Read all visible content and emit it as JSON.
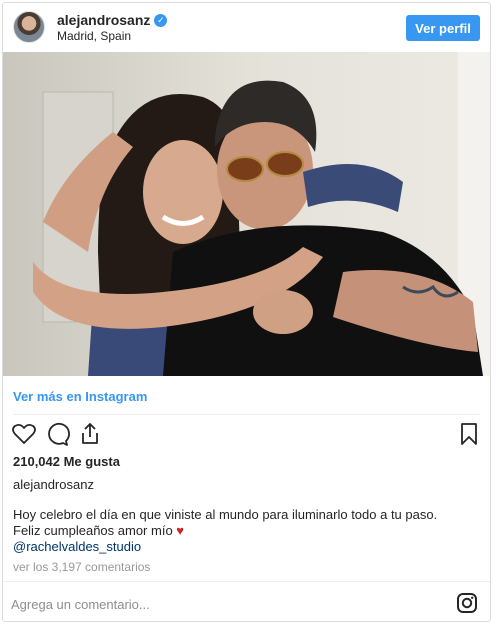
{
  "header": {
    "username": "alejandrosanz",
    "location": "Madrid, Spain",
    "verified_mark": "✓",
    "profile_button": "Ver perfil"
  },
  "photo": {
    "description_icon": "photo-of-couple"
  },
  "more_link": "Ver más en Instagram",
  "stats": {
    "likes": "210,042 Me gusta"
  },
  "caption": {
    "author": "alejandrosanz",
    "line1": "Hoy celebro el día en que viniste al mundo para iluminarlo todo a tu paso.",
    "line2": "Feliz cumpleaños amor mío",
    "heart": "♥",
    "mention": "@rachelvaldes_studio"
  },
  "comments_link": "ver los 3,197 comentarios",
  "comment_box": {
    "placeholder": "Agrega un comentario..."
  },
  "colors": {
    "accent": "#3897f0",
    "heart": "#c62828"
  },
  "icons": [
    "heart-icon",
    "comment-icon",
    "share-icon",
    "bookmark-icon",
    "instagram-icon",
    "verified-icon"
  ]
}
